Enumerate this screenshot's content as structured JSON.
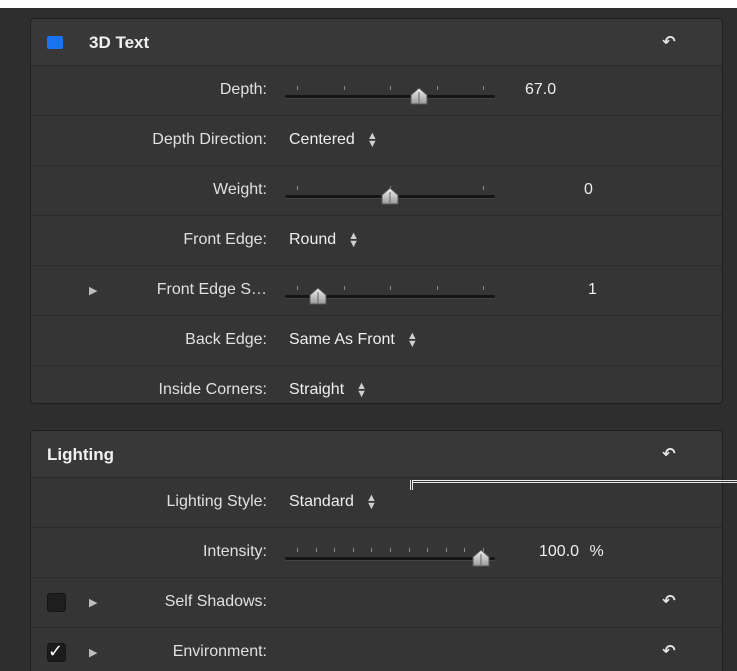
{
  "text3d": {
    "title": "3D Text",
    "rows": {
      "depth": {
        "label": "Depth:",
        "value": "67.0",
        "slider": 0.65
      },
      "depth_direction": {
        "label": "Depth Direction:",
        "value": "Centered"
      },
      "weight": {
        "label": "Weight:",
        "value": "0",
        "slider": 0.5
      },
      "front_edge": {
        "label": "Front Edge:",
        "value": "Round"
      },
      "front_edge_size": {
        "label": "Front Edge S…",
        "value": "1",
        "slider": 0.12
      },
      "back_edge": {
        "label": "Back Edge:",
        "value": "Same As Front"
      },
      "inside_corners": {
        "label": "Inside Corners:",
        "value": "Straight"
      }
    }
  },
  "lighting": {
    "title": "Lighting",
    "rows": {
      "lighting_style": {
        "label": "Lighting Style:",
        "value": "Standard"
      },
      "intensity": {
        "label": "Intensity:",
        "value": "100.0",
        "unit": "%",
        "slider": 0.98
      },
      "self_shadows": {
        "label": "Self Shadows:",
        "checked": false
      },
      "environment": {
        "label": "Environment:",
        "checked": true
      }
    }
  },
  "icons": {
    "reset": "reset-arrow-icon",
    "popup": "popup-arrows-icon",
    "disclosure": "disclosure-triangle-icon",
    "checkmark": "checkmark-icon"
  },
  "colors": {
    "panel_bg": "#2e2e2e",
    "section_bg": "#353535",
    "accent_blue": "#1a74f2",
    "text": "#e2e2e2"
  }
}
